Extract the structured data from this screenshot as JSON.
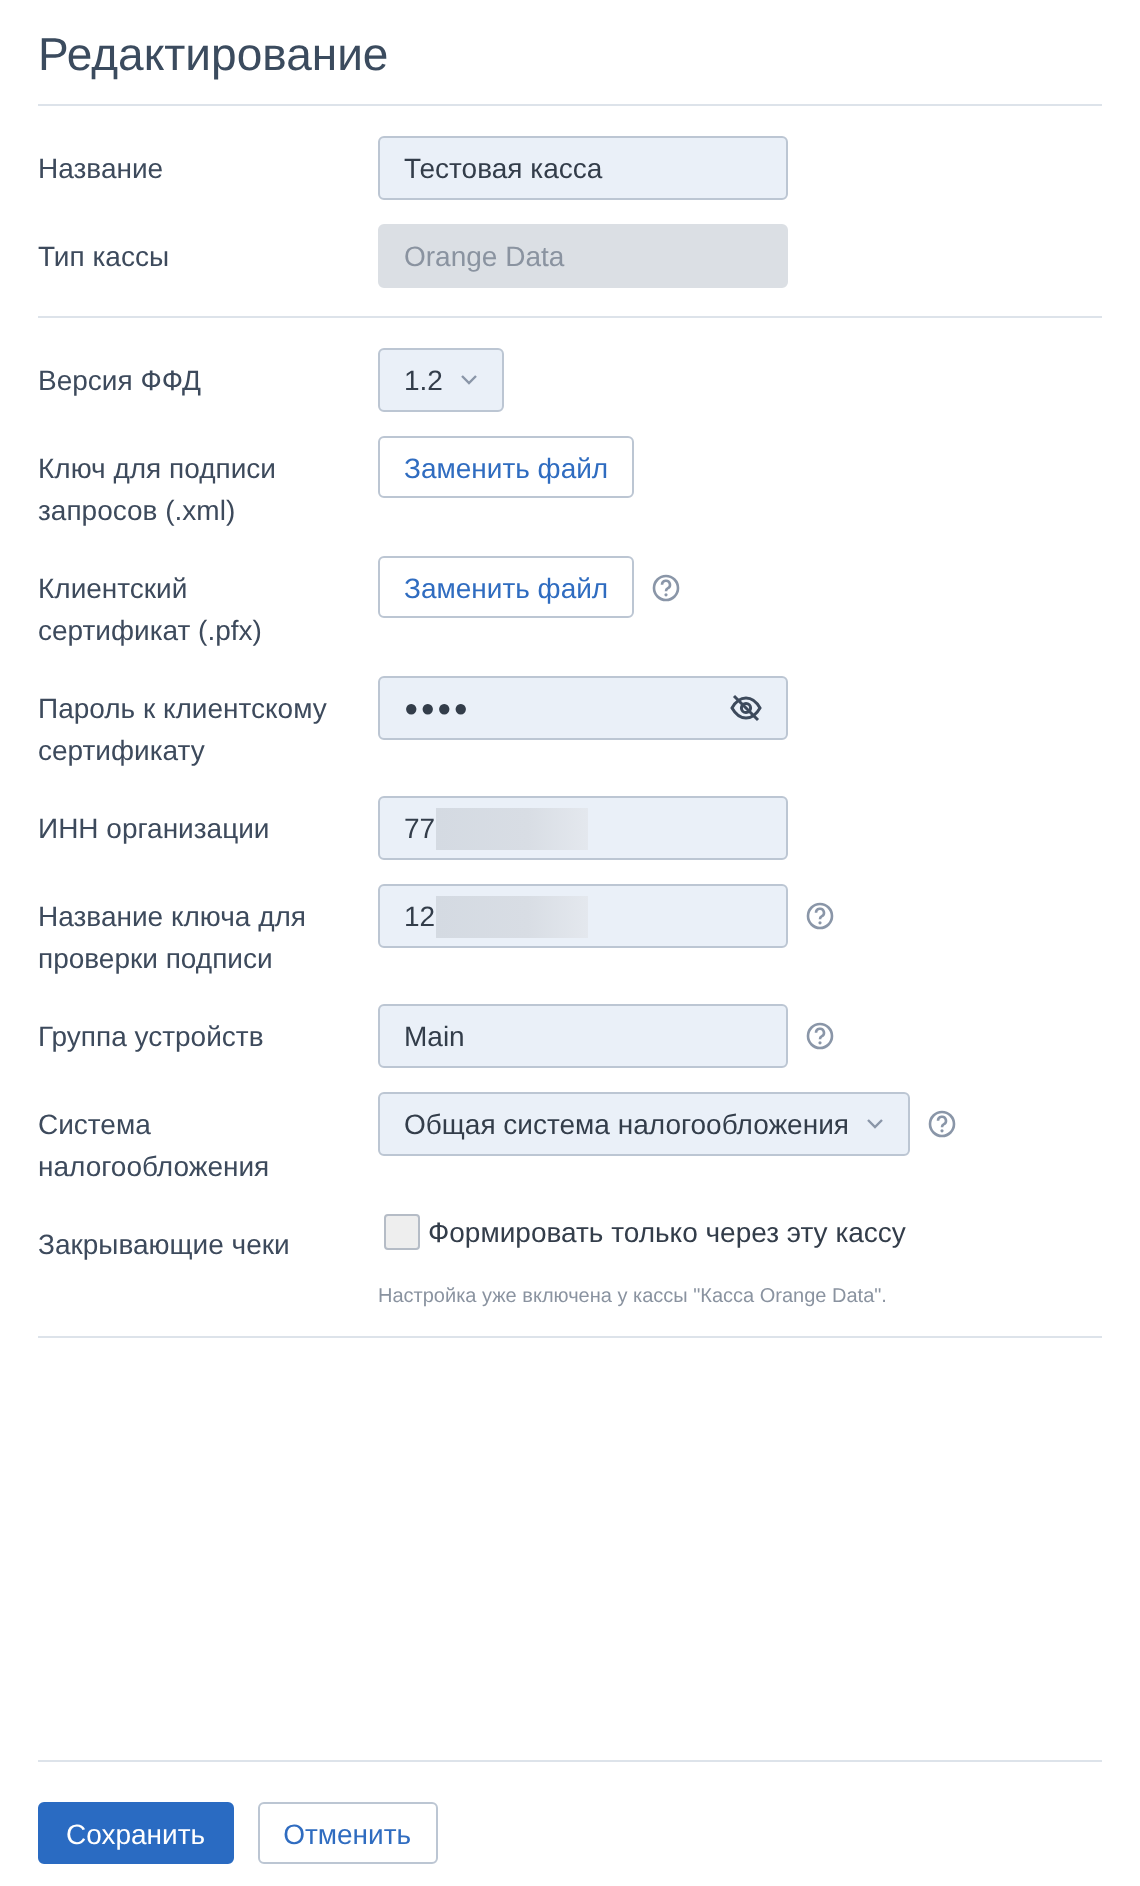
{
  "title": "Редактирование",
  "sections": [
    [
      {
        "kind": "text",
        "label": "Название",
        "value": "Тестовая касса"
      },
      {
        "kind": "disabled",
        "label": "Тип кассы",
        "value": "Orange Data"
      }
    ],
    [
      {
        "kind": "select",
        "label": "Версия ФФД",
        "value": "1.2"
      },
      {
        "kind": "file",
        "label": "Ключ для подписи запросов (.xml)",
        "button": "Заменить файл"
      },
      {
        "kind": "file",
        "label": "Клиентский сертификат (.pfx)",
        "button": "Заменить файл",
        "help": true
      },
      {
        "kind": "password",
        "label": "Пароль к клиентскому сертификату",
        "value": "●●●●"
      },
      {
        "kind": "text",
        "label": "ИНН организации",
        "value": "77",
        "redacted": true
      },
      {
        "kind": "text",
        "label": "Название ключа для проверки подписи",
        "value": "12",
        "redacted": true,
        "help": true
      },
      {
        "kind": "text",
        "label": "Группа устройств",
        "value": "Main",
        "help": true
      },
      {
        "kind": "select",
        "label": "Система налогообложения",
        "value": "Общая система налогообложения",
        "help": true
      },
      {
        "kind": "checkbox",
        "label": "Закрывающие чеки",
        "option": "Формировать только через эту кассу",
        "checked": false,
        "hint": "Настройка уже включена у кассы \"Касса Orange Data\"."
      }
    ]
  ],
  "buttons": [
    {
      "label": "Сохранить",
      "primary": true
    },
    {
      "label": "Отменить",
      "primary": false
    }
  ]
}
